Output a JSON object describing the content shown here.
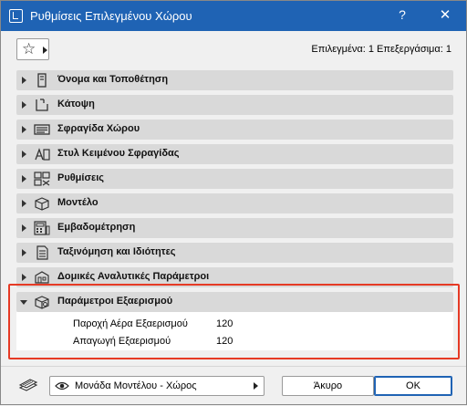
{
  "window": {
    "title": "Ρυθμίσεις Επιλεγμένου Χώρου",
    "help_label": "?",
    "close_label": "✕"
  },
  "toolbar": {
    "favorites_icon": "star-icon",
    "selection_info": "Επιλεγμένα: 1 Επεξεργάσιμα: 1"
  },
  "panels": [
    {
      "label": "Όνομα και Τοποθέτηση",
      "icon": "name-tag-icon"
    },
    {
      "label": "Κάτοψη",
      "icon": "floor-plan-icon"
    },
    {
      "label": "Σφραγίδα Χώρου",
      "icon": "zone-stamp-icon"
    },
    {
      "label": "Στυλ Κειμένου Σφραγίδας",
      "icon": "text-style-icon"
    },
    {
      "label": "Ρυθμίσεις",
      "icon": "settings-grid-icon"
    },
    {
      "label": "Μοντέλο",
      "icon": "model-box-icon"
    },
    {
      "label": "Εμβαδομέτρηση",
      "icon": "area-calc-icon"
    },
    {
      "label": "Ταξινόμηση και Ιδιότητες",
      "icon": "classification-icon"
    },
    {
      "label": "Δομικές Αναλυτικές Παράμετροι",
      "icon": "structural-icon"
    },
    {
      "label": "Παράμετροι Εξαερισμού",
      "icon": "ventilation-icon"
    }
  ],
  "ventilation": {
    "rows": [
      {
        "name": "Παροχή Αέρα Εξαερισμού",
        "value": "120"
      },
      {
        "name": "Απαγωγή Εξαερισμού",
        "value": "120"
      }
    ]
  },
  "footer": {
    "layer_icon": "layers-icon",
    "view_select_label": "Μονάδα Μοντέλου - Χώρος",
    "cancel_label": "Άκυρο",
    "ok_label": "OK"
  },
  "colors": {
    "titlebar": "#1f63b4",
    "highlight": "#e63a25",
    "panel_header": "#d9d9d9"
  }
}
